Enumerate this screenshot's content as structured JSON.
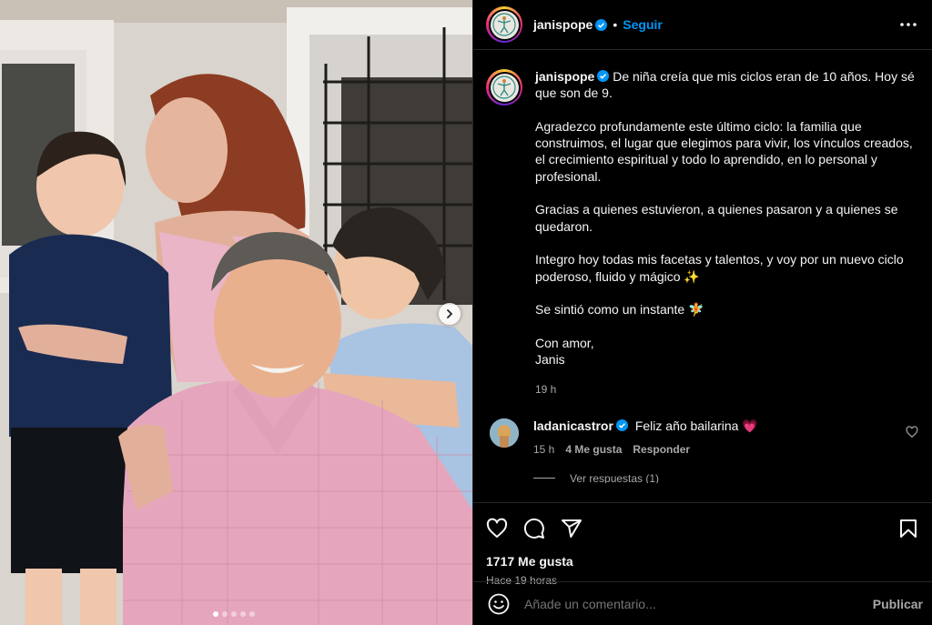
{
  "colors": {
    "link": "#0095f6",
    "background": "#000000",
    "muted": "#a8a8a8",
    "heart": "#ff3040"
  },
  "header": {
    "username": "janispope",
    "separator": "•",
    "follow_label": "Seguir",
    "more_icon": "more-horizontal-icon"
  },
  "caption": {
    "username": "janispope",
    "paragraphs": [
      "De niña creía que mis ciclos eran de 10 años. Hoy sé que son de 9.",
      "Agradezco profundamente este último ciclo: la familia que construimos, el lugar que elegimos para vivir, los vínculos creados, el crecimiento espiritual y todo lo aprendido, en lo personal y profesional.",
      "Gracias a quienes estuvieron, a quienes pasaron y a quienes se quedaron.",
      "Integro hoy todas mis facetas y talentos, y voy por un nuevo ciclo poderoso, fluido y mágico ✨",
      "Se sintió como un instante 🧚",
      "Con amor,",
      "Janis"
    ],
    "time": "19 h"
  },
  "comment": {
    "username": "ladanicastror",
    "text": "Feliz año bailarina 💗",
    "time": "15 h",
    "likes": "4 Me gusta",
    "reply_label": "Responder",
    "view_replies": "Ver respuestas (1)"
  },
  "actions": {
    "icons": [
      "heart-icon",
      "comment-icon",
      "share-icon",
      "bookmark-icon"
    ],
    "likes_text": "1717 Me gusta",
    "ago_text": "Hace 19 horas"
  },
  "add_comment": {
    "placeholder": "Añade un comentario...",
    "publish_label": "Publicar"
  },
  "carousel": {
    "total": 5,
    "current": 1
  }
}
